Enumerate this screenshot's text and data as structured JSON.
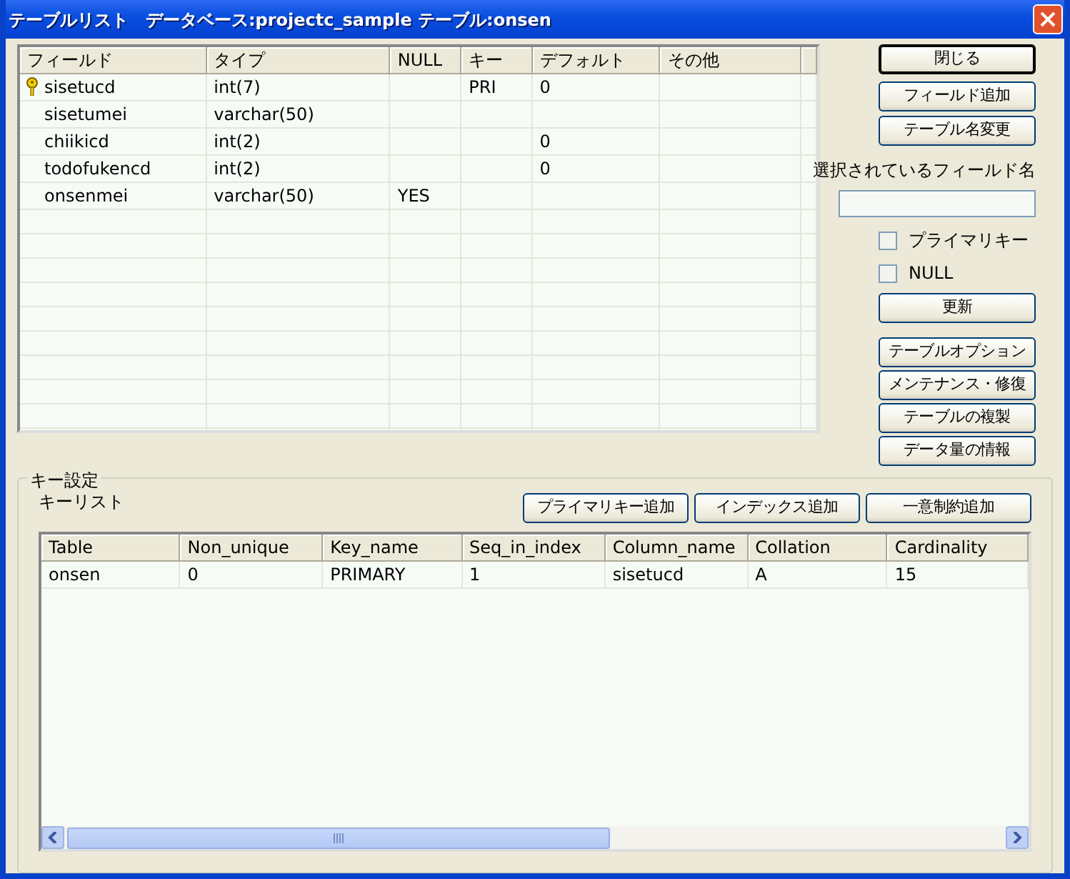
{
  "window": {
    "title": "テーブルリスト　データベース:projectc_sample テーブル:onsen"
  },
  "field_table": {
    "columns": [
      "フィールド",
      "タイプ",
      "NULL",
      "キー",
      "デフォルト",
      "その他"
    ],
    "rows": [
      {
        "primary_key": true,
        "cells": [
          "sisetucd",
          "int(7)",
          "",
          "PRI",
          "0",
          ""
        ]
      },
      {
        "primary_key": false,
        "cells": [
          "sisetumei",
          "varchar(50)",
          "",
          "",
          "",
          ""
        ]
      },
      {
        "primary_key": false,
        "cells": [
          "chiikicd",
          "int(2)",
          "",
          "",
          "0",
          ""
        ]
      },
      {
        "primary_key": false,
        "cells": [
          "todofukencd",
          "int(2)",
          "",
          "",
          "0",
          ""
        ]
      },
      {
        "primary_key": false,
        "cells": [
          "onsenmei",
          "varchar(50)",
          "YES",
          "",
          "",
          ""
        ]
      }
    ]
  },
  "side_buttons_top": [
    {
      "label": "閉じる",
      "default": true
    },
    {
      "label": "フィールド追加",
      "default": false
    },
    {
      "label": "テーブル名変更",
      "default": false
    }
  ],
  "selected_field": {
    "label": "選択されているフィールド名"
  },
  "checkboxes": [
    {
      "label": "プライマリキー",
      "checked": false
    },
    {
      "label": "NULL",
      "checked": false
    }
  ],
  "update_button": "更新",
  "side_buttons_bottom": [
    "テーブルオプション",
    "メンテナンス・修復",
    "テーブルの複製",
    "データ量の情報"
  ],
  "key_settings": {
    "title": "キー設定",
    "list_label": "キーリスト",
    "buttons": [
      "プライマリキー追加",
      "インデックス追加",
      "一意制約追加"
    ],
    "columns": [
      "Table",
      "Non_unique",
      "Key_name",
      "Seq_in_index",
      "Column_name",
      "Collation",
      "Cardinality"
    ],
    "rows": [
      [
        "onsen",
        "0",
        "PRIMARY",
        "1",
        "sisetucd",
        "A",
        "15"
      ]
    ]
  }
}
